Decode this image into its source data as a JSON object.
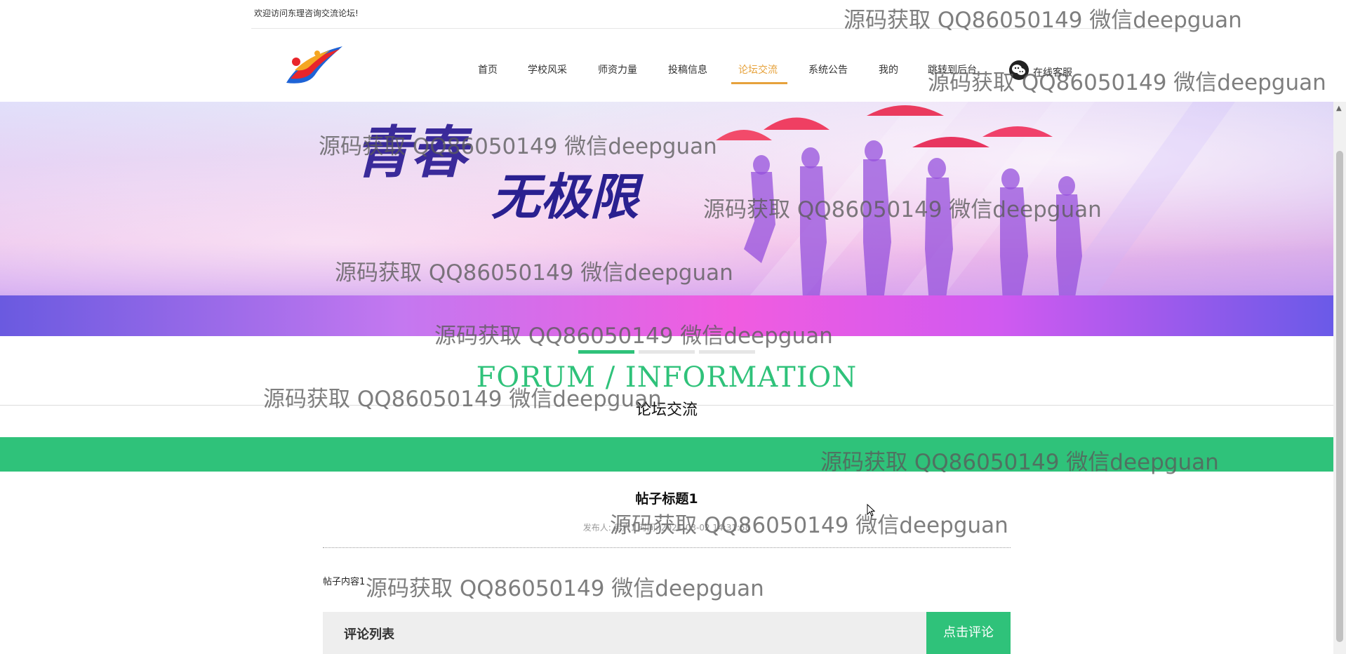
{
  "topbar": {
    "welcome": "欢迎访问东理咨询交流论坛!"
  },
  "nav": {
    "items": [
      {
        "label": "首页"
      },
      {
        "label": "学校风采"
      },
      {
        "label": "师资力量"
      },
      {
        "label": "投稿信息"
      },
      {
        "label": "论坛交流",
        "active": true
      },
      {
        "label": "系统公告"
      },
      {
        "label": "我的"
      },
      {
        "label": "跳转到后台"
      }
    ],
    "chat_label": "在线客服",
    "active_color": "#e6a23c"
  },
  "banner": {
    "line1": "青春",
    "line2": "无极限"
  },
  "carousel": {
    "count": 3,
    "active_index": 0
  },
  "section": {
    "title_en": "FORUM / INFORMATION",
    "title_cn": "论坛交流"
  },
  "post": {
    "title": "帖子标题1",
    "meta": "发布人: 用户1   时间: 2021-03-02 14:31:58",
    "content": "帖子内容1"
  },
  "comments": {
    "title": "评论列表",
    "button_label": "点击评论"
  },
  "colors": {
    "accent_green": "#2fc27a",
    "nav_active": "#e6a23c"
  },
  "watermark": "源码获取 QQ86050149 微信deepguan"
}
